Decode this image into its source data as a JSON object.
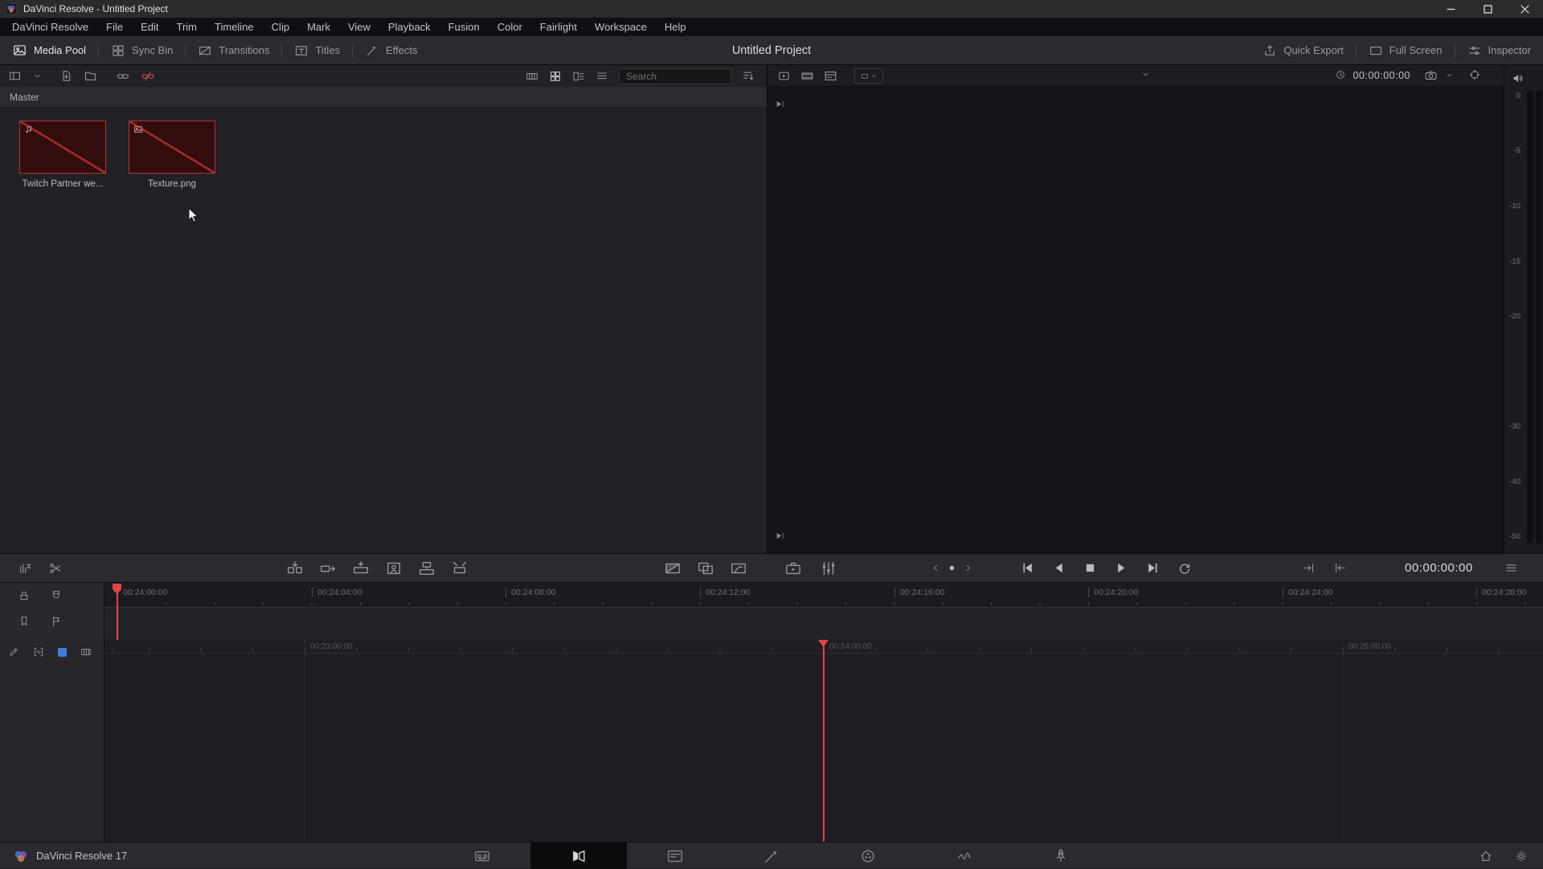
{
  "colors": {
    "accent_red": "#e14646",
    "clip_border_red": "#b03434",
    "clip_bg_red": "#330d0d",
    "track_blue": "#3f7fd9"
  },
  "window": {
    "title": "DaVinci Resolve - Untitled Project"
  },
  "menu": {
    "items": [
      "DaVinci Resolve",
      "File",
      "Edit",
      "Trim",
      "Timeline",
      "Clip",
      "Mark",
      "View",
      "Playback",
      "Fusion",
      "Color",
      "Fairlight",
      "Workspace",
      "Help"
    ]
  },
  "header": {
    "buttons_left": [
      "Media Pool",
      "Sync Bin",
      "Transitions",
      "Titles",
      "Effects"
    ],
    "project_title": "Untitled Project",
    "buttons_right": [
      "Quick Export",
      "Full Screen",
      "Inspector"
    ]
  },
  "media_pool": {
    "bin_name": "Master",
    "search_placeholder": "Search",
    "clips": [
      {
        "name": "Twitch Partner we...",
        "icon": "music-note-icon"
      },
      {
        "name": "Texture.png",
        "icon": "image-icon"
      }
    ]
  },
  "viewer": {
    "timecode": "00:00:00:00"
  },
  "audio_meter": {
    "scale": [
      "0",
      "-5",
      "-10",
      "-15",
      "-20",
      "-30",
      "-40",
      "-50"
    ]
  },
  "transport": {
    "timecode": "00:00:00:00"
  },
  "timeline": {
    "upper_ruler_labels": [
      "00:24:00:00",
      "00:24:04:00",
      "00:24:08:00",
      "00:24:12:00",
      "00:24:16:00",
      "00:24:20:00",
      "00:24:24:00",
      "00:24:28:00"
    ],
    "lower_ruler_labels": [
      "00:23:00:00",
      "00:24:00:00",
      "00:25:00:00"
    ]
  },
  "status_bar": {
    "app_label": "DaVinci Resolve 17",
    "page_icons": [
      "media-page-icon",
      "cut-page-icon",
      "edit-page-icon",
      "fusion-page-icon",
      "color-page-icon",
      "fairlight-page-icon",
      "deliver-page-icon"
    ],
    "active_page": "cut"
  }
}
